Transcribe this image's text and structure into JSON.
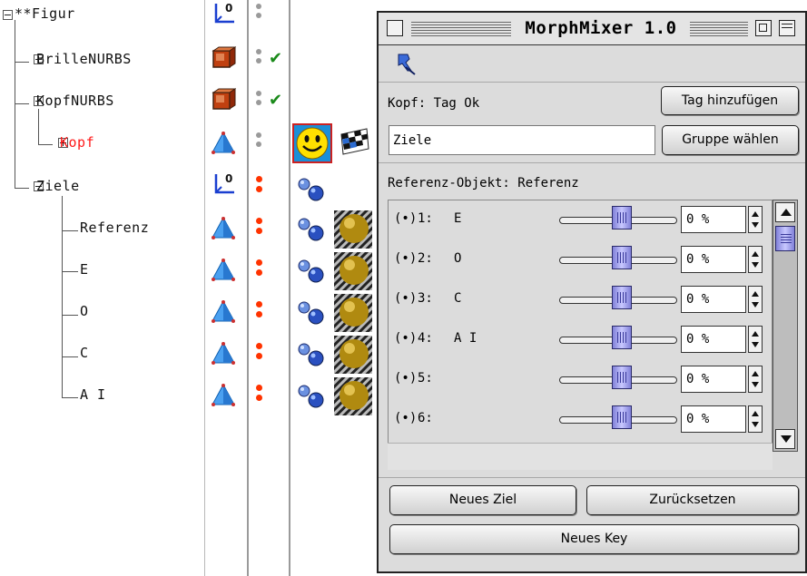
{
  "object_manager": {
    "rows": [
      {
        "name": "**Figur"
      },
      {
        "name": "BrilleNURBS"
      },
      {
        "name": "KopfNURBS"
      },
      {
        "name": "Kopf"
      },
      {
        "name": "Ziele"
      },
      {
        "name": "Referenz"
      },
      {
        "name": "E"
      },
      {
        "name": "O"
      },
      {
        "name": "C"
      },
      {
        "name": "A I"
      }
    ],
    "colors": {
      "selected_object": "#ff1a1a",
      "enabled_check": "#1a8a1a",
      "dots_red": "#ff3300",
      "dots_grey": "#9a9a9a"
    },
    "check_glyph": "✔",
    "icons": [
      "null-object-icon",
      "nurbs-cube-icon",
      "polygon-object-icon",
      "display-tag-icon",
      "texture-tag-icon",
      "morph-tag-icon",
      "material-ball-icon"
    ]
  },
  "morph_mixer": {
    "title": "MorphMixer 1.0",
    "tag_label": "Kopf: Tag Ok",
    "add_tag_button": "Tag hinzufügen",
    "group_value": "Ziele",
    "select_group_button": "Gruppe wählen",
    "reference_label": "Referenz-Objekt:  Referenz",
    "morphs": [
      {
        "radio": "(•)",
        "index": "1:",
        "name": "E",
        "percent": "0 %",
        "value": 0.54
      },
      {
        "radio": "(•)",
        "index": "2:",
        "name": "O",
        "percent": "0 %",
        "value": 0.54
      },
      {
        "radio": "(•)",
        "index": "3:",
        "name": "C",
        "percent": "0 %",
        "value": 0.54
      },
      {
        "radio": "(•)",
        "index": "4:",
        "name": "A I",
        "percent": "0 %",
        "value": 0.54
      },
      {
        "radio": "(•)",
        "index": "5:",
        "name": "",
        "percent": "0 %",
        "value": 0.54
      },
      {
        "radio": "(•)",
        "index": "6:",
        "name": "",
        "percent": "0 %",
        "value": 0.54
      }
    ],
    "new_target_button": "Neues Ziel",
    "reset_button": "Zurücksetzen",
    "new_key_button": "Neues Key",
    "accent_color": "#8080d8"
  }
}
